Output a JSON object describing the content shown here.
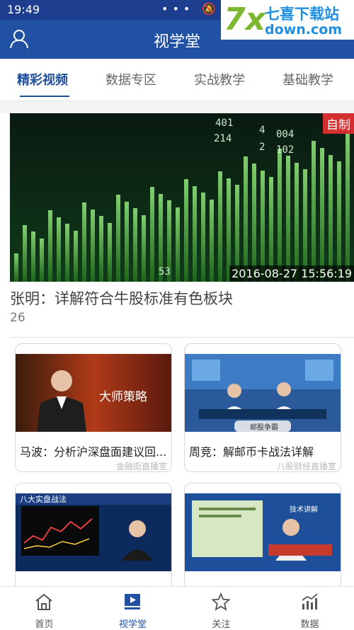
{
  "status_bar": {
    "time": "19:49",
    "icons": "••• 🔕 ✦ ▮"
  },
  "watermark": {
    "seven": "7x",
    "name": "七喜下载站",
    "url": "down.com"
  },
  "header": {
    "title": "视学堂"
  },
  "tabs": [
    {
      "label": "精彩视频",
      "active": true
    },
    {
      "label": "数据专区",
      "active": false
    },
    {
      "label": "实战教学",
      "active": false
    },
    {
      "label": "基础教学",
      "active": false
    }
  ],
  "feature": {
    "tag": "自制",
    "date": "2016-08-27 15:56:19",
    "title": "张明：详解符合牛股标准有色板块",
    "count": "26",
    "image_text": [
      "401",
      "4",
      "214",
      "004",
      "2",
      "102",
      "53"
    ]
  },
  "cards": [
    {
      "title": "马波：分析沪深盘面建议回...",
      "source": "金融街直播室",
      "banner": "大师策略"
    },
    {
      "title": "周竞：解邮币卡战法详解",
      "source": "八股财经直播室",
      "banner": "邮股争霸"
    },
    {
      "title": "",
      "source": "",
      "banner": "八大实盘战法"
    },
    {
      "title": "",
      "source": "",
      "banner": "技术讲解"
    }
  ],
  "bottom_nav": [
    {
      "label": "首页",
      "active": false
    },
    {
      "label": "视学堂",
      "active": true
    },
    {
      "label": "关注",
      "active": false
    },
    {
      "label": "数据",
      "active": false
    }
  ]
}
